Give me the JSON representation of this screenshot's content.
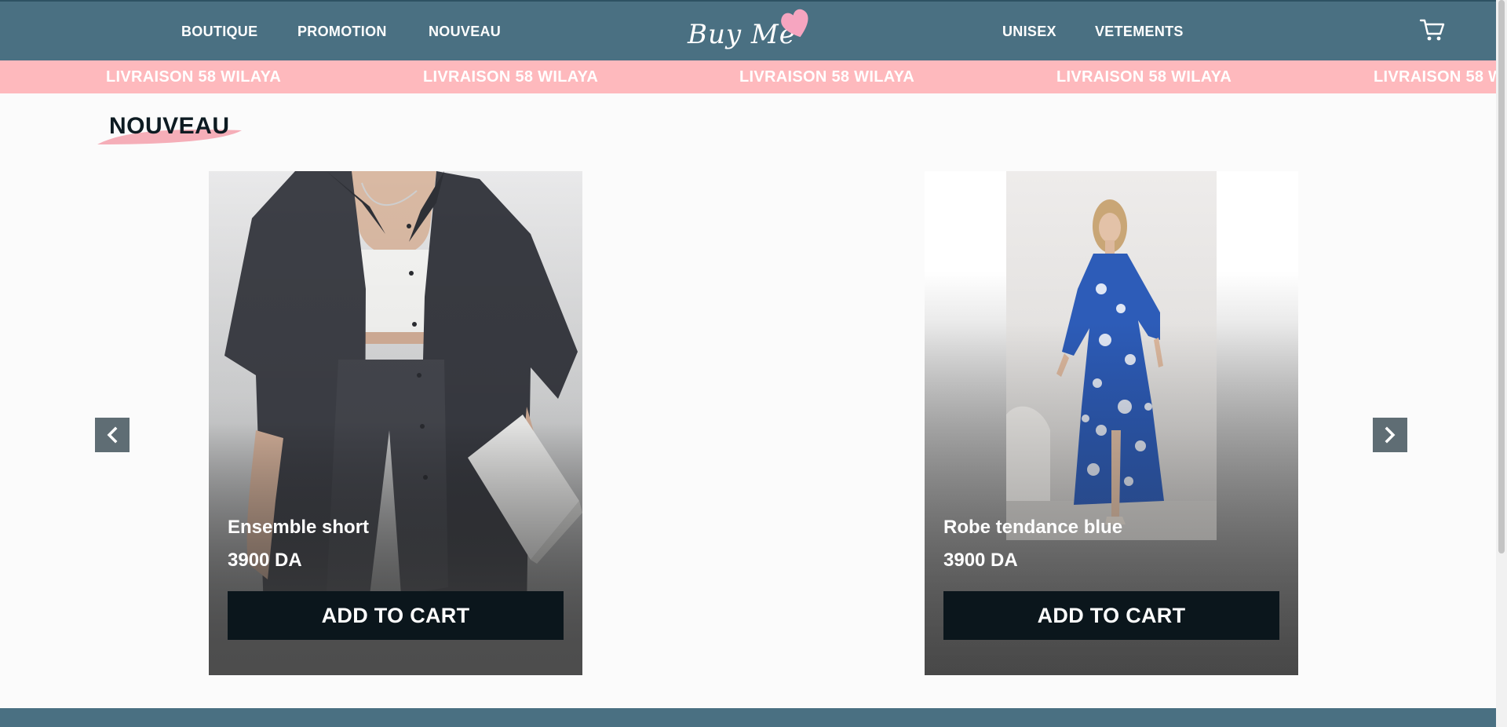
{
  "header": {
    "nav_left": [
      "BOUTIQUE",
      "PROMOTION",
      "NOUVEAU"
    ],
    "nav_right": [
      "UNISEX",
      "VETEMENTS"
    ],
    "logo_text": "Buy Me",
    "cart_icon": "cart-icon"
  },
  "marquee": {
    "text": "LIVRAISON 58 WILAYA"
  },
  "section": {
    "title": "NOUVEAU"
  },
  "carousel": {
    "prev_icon": "chevron-left-icon",
    "next_icon": "chevron-right-icon"
  },
  "products": [
    {
      "name": "Ensemble short",
      "price": "3900 DA",
      "button": "ADD TO CART"
    },
    {
      "name": "Robe tendance blue",
      "price": "3900 DA",
      "button": "ADD TO CART"
    }
  ],
  "colors": {
    "header_bg": "#4a7082",
    "marquee_bg": "#feb9bd",
    "accent_pink": "#f6a5c0",
    "button_bg": "#0b161c"
  }
}
